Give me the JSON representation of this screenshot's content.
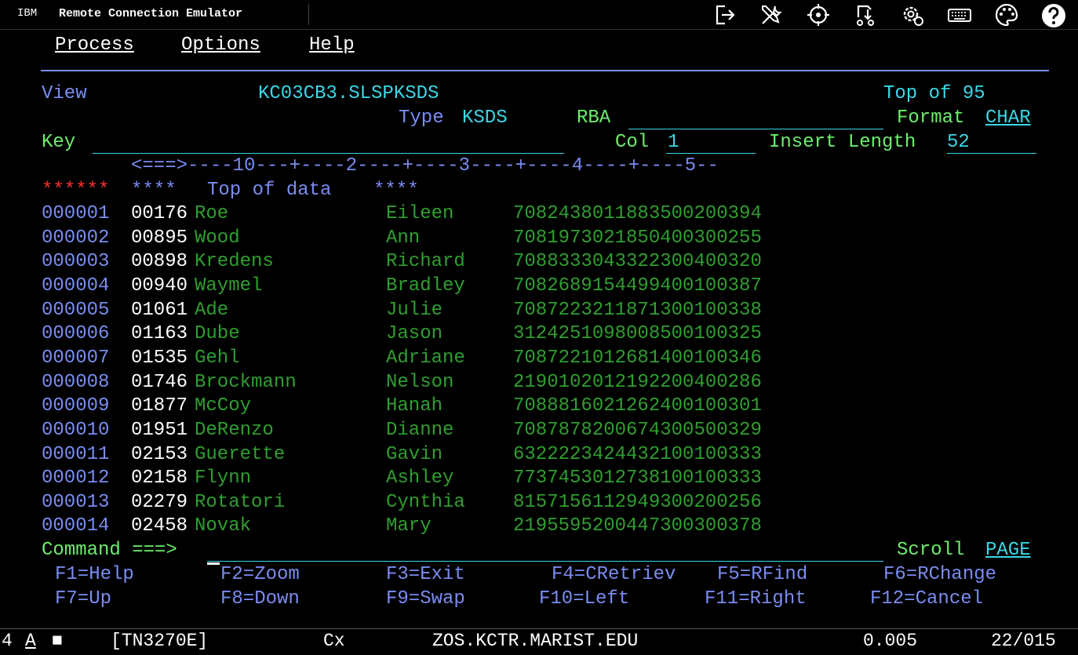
{
  "titlebar": {
    "brand": "IBM",
    "app_title": "Remote Connection Emulator",
    "icons": [
      "disconnect-icon",
      "tools-icon",
      "crosshair-icon",
      "macro-icon",
      "settings-icon",
      "keyboard-icon",
      "palette-icon",
      "help-icon"
    ]
  },
  "menu": {
    "process": "Process",
    "options": "Options",
    "help": "Help"
  },
  "header": {
    "mode": "View",
    "dataset": "KC03CB3.SLSPKSDS",
    "position": "Top of 95",
    "type_label": "Type",
    "type_value": "KSDS",
    "rba_label": "RBA",
    "rba_value": "",
    "format_label": "Format",
    "format_value": "CHAR",
    "key_label": "Key",
    "key_value": "",
    "col_label": "Col",
    "col_value": "1",
    "insert_length_label": "Insert Length",
    "insert_length_value": "52"
  },
  "ruler": "<===>----10---+----2----+----3----+----4----+----5--",
  "top_of_data": {
    "stars": "******",
    "left_marks": "****",
    "text": "Top of data",
    "right_marks": "****"
  },
  "records": [
    {
      "line": "000001",
      "key": "00176",
      "last": "Roe",
      "first": "Eileen",
      "data": "708243801188350020039​4"
    },
    {
      "line": "000002",
      "key": "00895",
      "last": "Wood",
      "first": "Ann",
      "data": "7081973021850400300255"
    },
    {
      "line": "000003",
      "key": "00898",
      "last": "Kredens",
      "first": "Richard",
      "data": "7088333043322300400320"
    },
    {
      "line": "000004",
      "key": "00940",
      "last": "Waymel",
      "first": "Bradley",
      "data": "7082689154499400100387"
    },
    {
      "line": "000005",
      "key": "01061",
      "last": "Ade",
      "first": "Julie",
      "data": "7087223211871300100338"
    },
    {
      "line": "000006",
      "key": "01163",
      "last": "Dube",
      "first": "Jason",
      "data": "3124251098008500100325"
    },
    {
      "line": "000007",
      "key": "01535",
      "last": "Gehl",
      "first": "Adriane",
      "data": "7087221012681400100346"
    },
    {
      "line": "000008",
      "key": "01746",
      "last": "Brockmann",
      "first": "Nelson",
      "data": "2190102012192200400286"
    },
    {
      "line": "000009",
      "key": "01877",
      "last": "McCoy",
      "first": "Hanah",
      "data": "7088816021262400100301"
    },
    {
      "line": "000010",
      "key": "01951",
      "last": "DeRenzo",
      "first": "Dianne",
      "data": "7087878200674300500329"
    },
    {
      "line": "000011",
      "key": "02153",
      "last": "Guerette",
      "first": "Gavin",
      "data": "6322223424432100100333"
    },
    {
      "line": "000012",
      "key": "02158",
      "last": "Flynn",
      "first": "Ashley",
      "data": "7737453012738100100333"
    },
    {
      "line": "000013",
      "key": "02279",
      "last": "Rotatori",
      "first": "Cynthia",
      "data": "8157156112949300200256"
    },
    {
      "line": "000014",
      "key": "02458",
      "last": "Novak",
      "first": "Mary",
      "data": "2195595200447300300378"
    }
  ],
  "command": {
    "label": "Command ===>",
    "value": "",
    "scroll_label": "Scroll",
    "scroll_value": "PAGE"
  },
  "fkeys_row1": [
    "F1=Help",
    "F2=Zoom",
    "F3=Exit",
    "F4=CRetriev",
    "F5=RFind",
    "F6=RChange"
  ],
  "fkeys_row2": [
    "F7=Up",
    "F8=Down",
    "F9=Swap",
    "F10=Left",
    "F11=Right",
    "F12=Cancel"
  ],
  "status": {
    "session": "4",
    "mode": "A",
    "indicator": "■",
    "protocol": "[TN3270E]",
    "conn": "Cx",
    "host": "ZOS.KCTR.MARIST.EDU",
    "time": "0.005",
    "cursor_pos": "22/015"
  },
  "colors": {
    "background": "#000000",
    "blue": "#7b8cf2",
    "turquoise": "#39d8e8",
    "green": "#6cef6c",
    "dark_green": "#2f9f2f",
    "red": "#ff3030",
    "white": "#ffffff"
  }
}
